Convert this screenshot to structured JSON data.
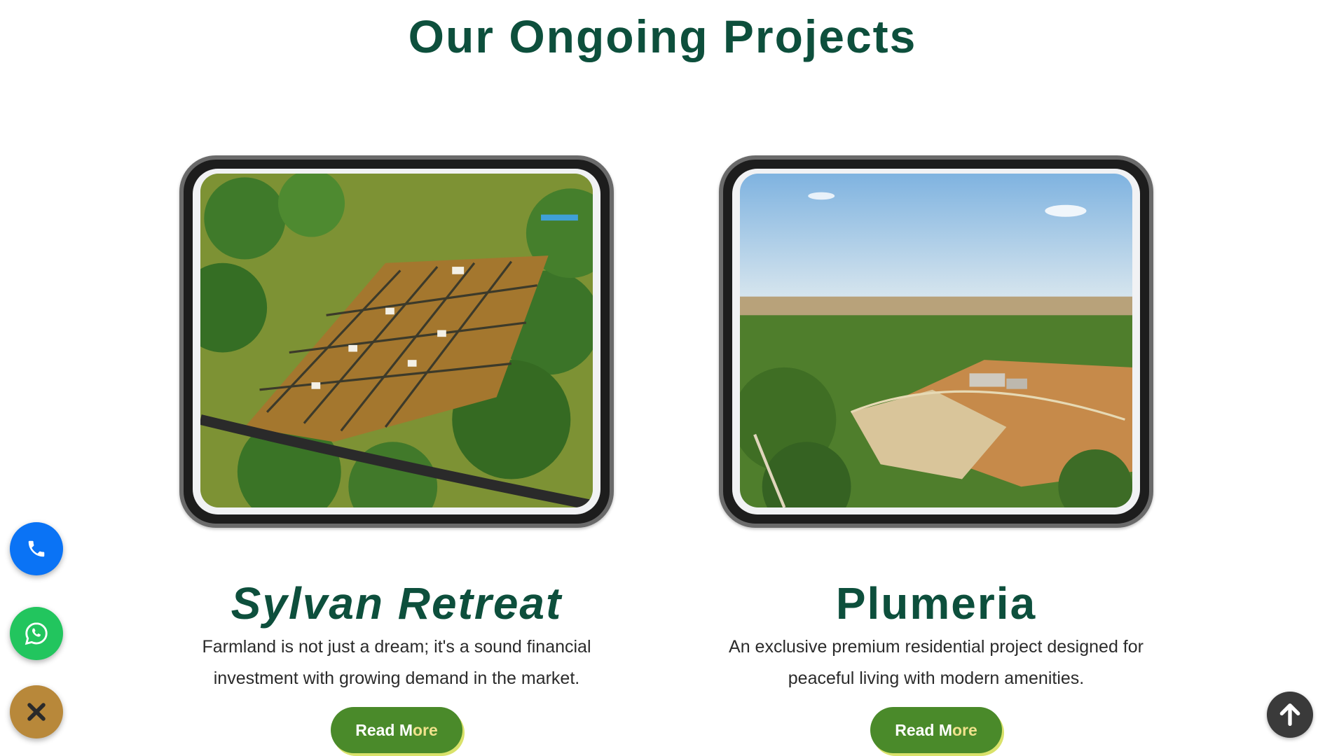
{
  "section": {
    "title": "Our Ongoing Projects"
  },
  "projects": [
    {
      "title": "Sylvan Retreat",
      "description": "Farmland is not just a dream; it's a sound financial investment with growing demand in the market.",
      "read_more_main": "Read M",
      "read_more_accent": "ore",
      "image_icon": "aerial-farmland-plots-photo"
    },
    {
      "title": "Plumeria",
      "description": "An exclusive premium residential project designed for peaceful living with modern amenities.",
      "read_more_main": "Read M",
      "read_more_accent": "ore",
      "image_icon": "aerial-countryside-landscape-photo"
    }
  ],
  "floating_actions": {
    "phone_icon": "phone-icon",
    "whatsapp_icon": "whatsapp-icon",
    "close_icon": "close-icon",
    "scroll_top_icon": "arrow-up-icon"
  },
  "colors": {
    "heading": "#0d4f3c",
    "button": "#4a8a2a",
    "button_shadow": "#d9e26a",
    "phone": "#0a73f5",
    "whatsapp": "#22c55e",
    "close": "#b8883a",
    "scroll_top": "#3a3a3a"
  }
}
